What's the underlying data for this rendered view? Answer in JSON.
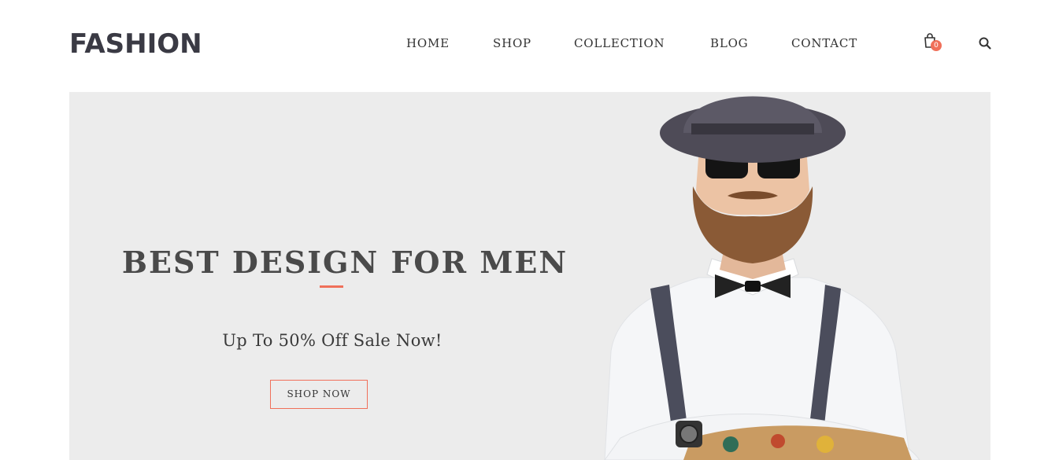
{
  "brand": {
    "logo_text": "FASHION"
  },
  "nav": {
    "items": [
      {
        "label": "HOME"
      },
      {
        "label": "SHOP"
      },
      {
        "label": "COLLECTION"
      },
      {
        "label": "BLOG"
      },
      {
        "label": "CONTACT"
      }
    ]
  },
  "cart": {
    "count": "0",
    "icon": "shopping-bag-icon"
  },
  "search": {
    "icon": "search-icon"
  },
  "hero": {
    "title": "BEST DESIGN FOR MEN",
    "subtitle": "Up To 50% Off Sale Now!",
    "button_label": "SHOP NOW",
    "image": "man-in-hat-sunglasses-bowtie-suspenders"
  },
  "colors": {
    "accent": "#f0705a",
    "hero_bg": "#ececec",
    "text_dark": "#4a4a4a",
    "logo": "#3a3a44"
  }
}
